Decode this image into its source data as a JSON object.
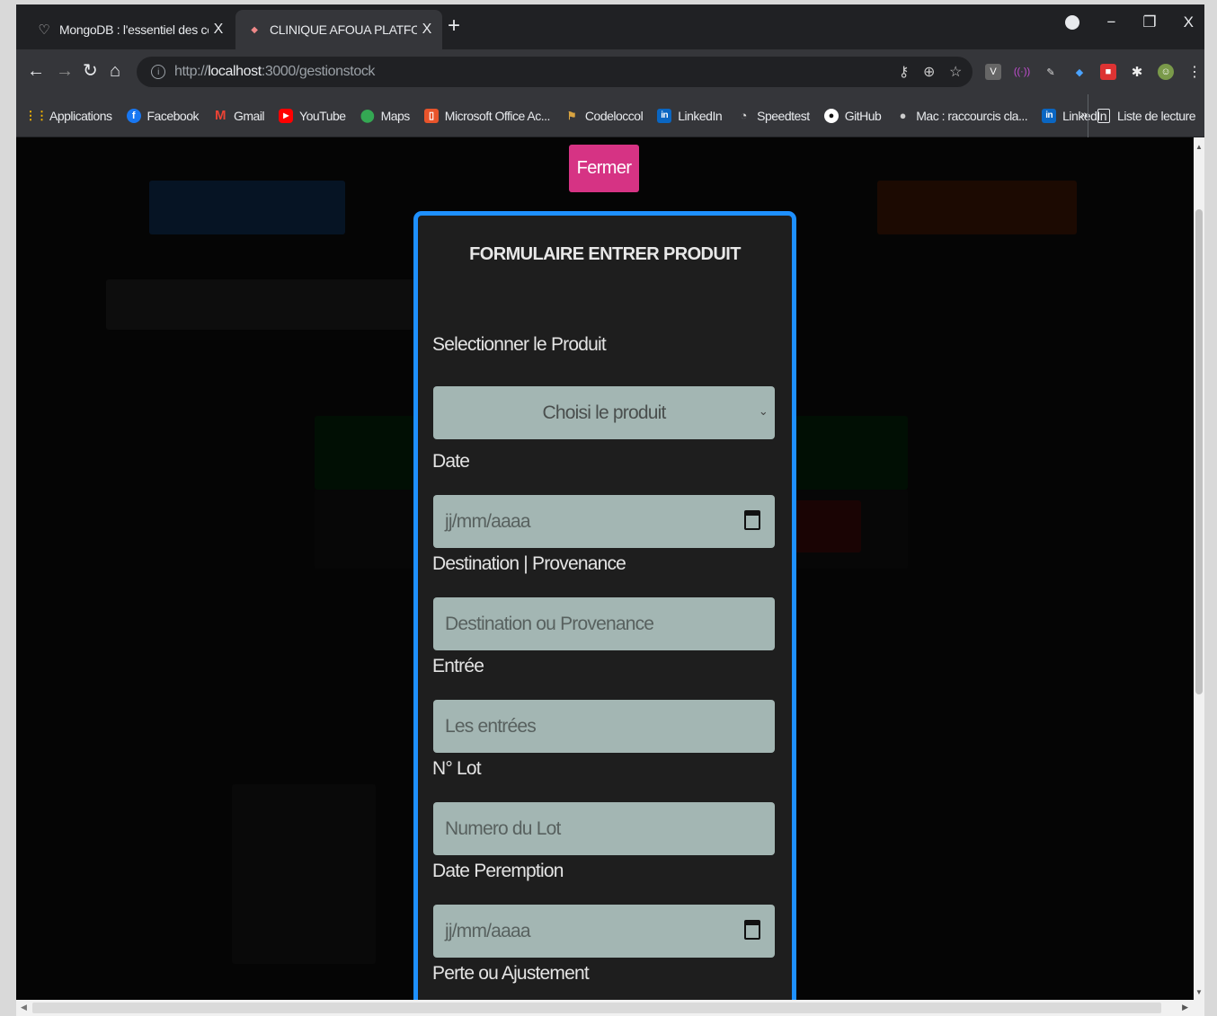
{
  "browser": {
    "tabs": [
      {
        "title": "MongoDB : l'essentiel des comm",
        "active": false
      },
      {
        "title": "CLINIQUE AFOUA PLATFORM",
        "active": true
      }
    ],
    "new_tab": "+",
    "close_glyph": "X",
    "url_scheme": "http://",
    "url_host": "localhost",
    "url_path": ":3000/gestionstock",
    "bookmarks": [
      {
        "label": "Applications",
        "icon": "apps-grid-icon"
      },
      {
        "label": "Facebook",
        "icon": "facebook-icon"
      },
      {
        "label": "Gmail",
        "icon": "gmail-icon"
      },
      {
        "label": "YouTube",
        "icon": "youtube-icon"
      },
      {
        "label": "Maps",
        "icon": "maps-icon"
      },
      {
        "label": "Microsoft Office Ac...",
        "icon": "office-icon"
      },
      {
        "label": "Codeloccol",
        "icon": "codeloccol-icon"
      },
      {
        "label": "LinkedIn",
        "icon": "linkedin-icon"
      },
      {
        "label": "Speedtest",
        "icon": "speedtest-icon"
      },
      {
        "label": "GitHub",
        "icon": "github-icon"
      },
      {
        "label": "Mac : raccourcis cla...",
        "icon": "apple-icon"
      },
      {
        "label": "LinkedIn",
        "icon": "linkedin-icon"
      }
    ],
    "bookmarks_more": "»",
    "reading_list": "Liste de lecture"
  },
  "page": {
    "close_button": "Fermer",
    "form": {
      "title": "FORMULAIRE ENTRER PRODUIT",
      "product_label": "Selectionner le Produit",
      "product_select_value": "Choisi le produit",
      "date_label": "Date",
      "date_placeholder": "jj/mm/aaaa",
      "destination_label": "Destination | Provenance",
      "destination_placeholder": "Destination ou Provenance",
      "entry_label": "Entrée",
      "entry_placeholder": "Les entrées",
      "lot_label": "N° Lot",
      "lot_placeholder": "Numero du Lot",
      "expiry_label": "Date Peremption",
      "expiry_placeholder": "jj/mm/aaaa",
      "loss_label": "Perte ou Ajustement"
    }
  },
  "colors": {
    "close_button": "#d63384",
    "modal_border": "#1e90ff",
    "field_bg": "#a3b6b3"
  }
}
